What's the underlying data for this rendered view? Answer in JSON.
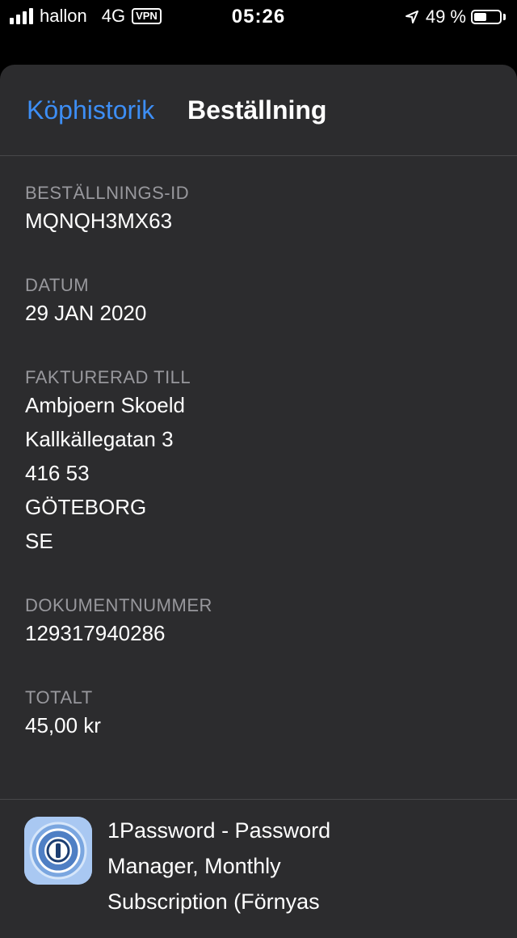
{
  "status_bar": {
    "carrier": "hallon",
    "network": "4G",
    "vpn": "VPN",
    "time": "05:26",
    "battery_percent": "49 %",
    "battery_level": 0.49,
    "signal_bars": 4
  },
  "nav": {
    "back_label": "Köphistorik",
    "title": "Beställning"
  },
  "order": {
    "order_id_label": "BESTÄLLNINGS-ID",
    "order_id": "MQNQH3MX63",
    "date_label": "DATUM",
    "date": "29 JAN 2020",
    "billed_to_label": "FAKTURERAD TILL",
    "billed_to": [
      "Ambjoern Skoeld",
      "Kallkällegatan 3",
      "416 53",
      "GÖTEBORG",
      "SE"
    ],
    "document_number_label": "DOKUMENTNUMMER",
    "document_number": "129317940286",
    "total_label": "TOTALT",
    "total": "45,00 kr"
  },
  "item": {
    "icon": "1password-app-icon",
    "name_lines": [
      "1Password - Password",
      "Manager, Monthly",
      "Subscription (Förnyas"
    ]
  },
  "colors": {
    "accent": "#3d8ef5",
    "sheet_bg": "#2c2c2e",
    "label": "#98989d"
  }
}
